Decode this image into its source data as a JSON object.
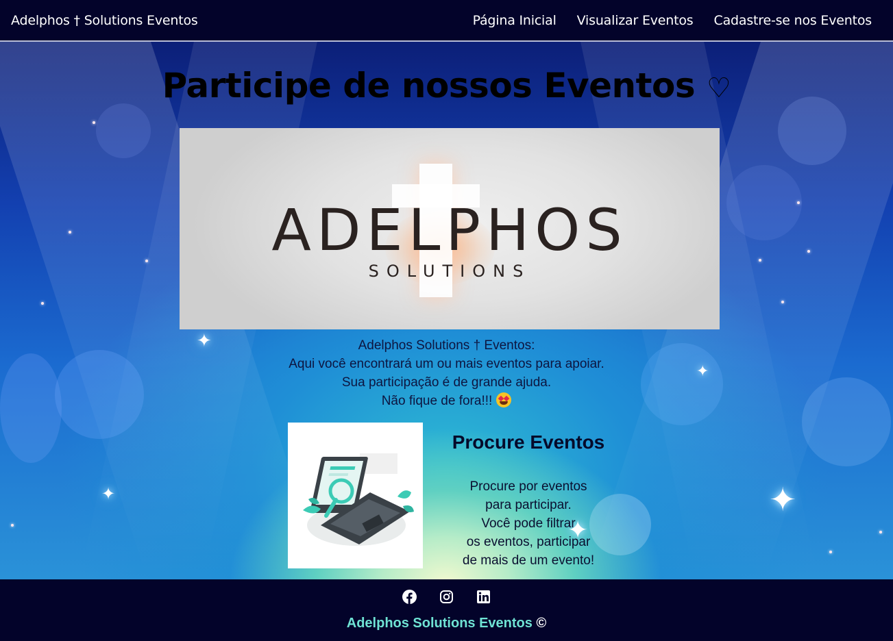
{
  "navbar": {
    "brand": "Adelphos † Solutions Eventos",
    "links": [
      {
        "label": "Página Inicial"
      },
      {
        "label": "Visualizar Eventos"
      },
      {
        "label": "Cadastre-se nos Eventos"
      }
    ]
  },
  "main": {
    "title": "Participe de nossos Eventos",
    "title_symbol": "♡",
    "banner": {
      "logo_word": "ADELPHOS",
      "logo_sub": "SOLUTIONS"
    },
    "intro_lines": [
      "Adelphos Solutions † Eventos:",
      "Aqui você encontrará um ou mais eventos para apoiar.",
      "Sua participação é de grande ajuda.",
      "Não fique de fora!!!"
    ],
    "card": {
      "title": "Procure Eventos",
      "text_lines": [
        "Procure por eventos",
        "para participar.",
        "Você pode filtrar",
        "os eventos, participar",
        "de mais de um evento!"
      ]
    }
  },
  "footer": {
    "social_icons": [
      "facebook-icon",
      "instagram-icon",
      "linkedin-icon"
    ],
    "text": "Adelphos Solutions Eventos",
    "copyright_symbol": "©"
  },
  "colors": {
    "navbar_bg": "#03032a",
    "footer_text": "#6fe3d4",
    "title_text": "#000000"
  }
}
